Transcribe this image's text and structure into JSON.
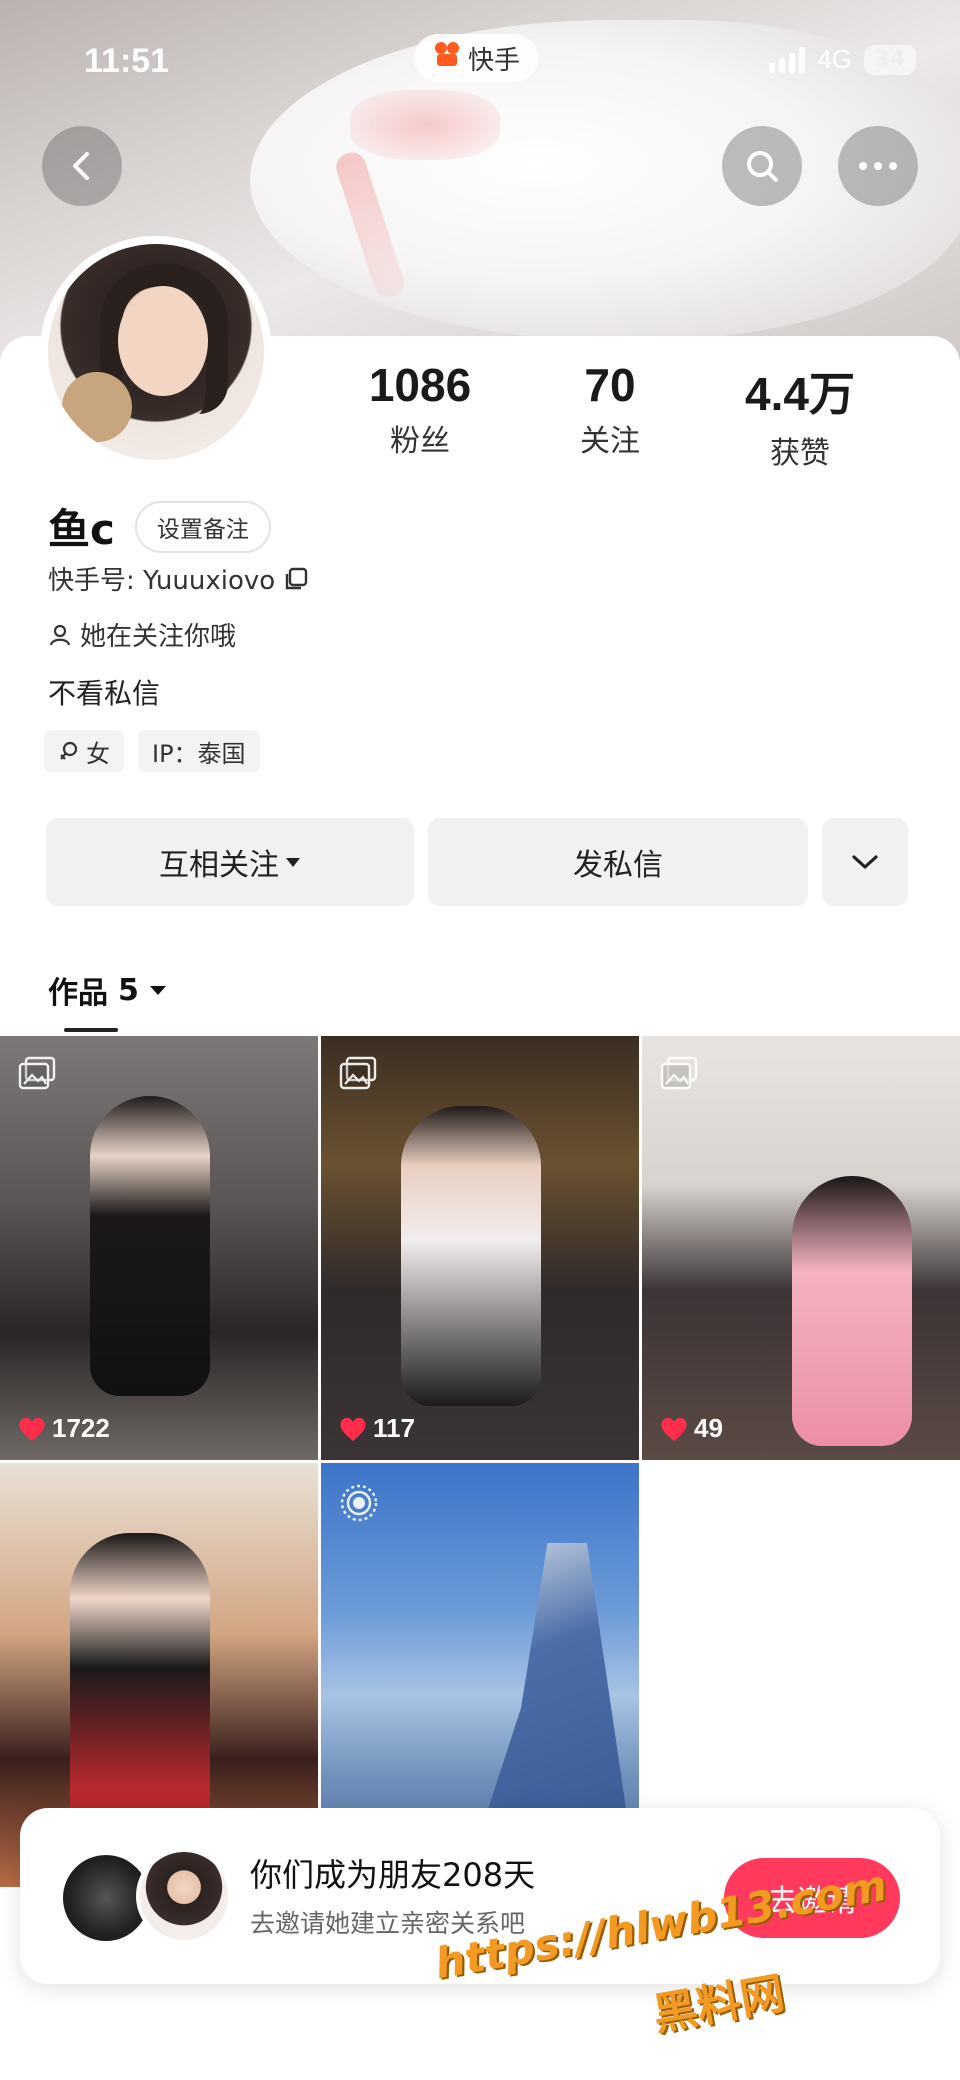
{
  "status_bar": {
    "time": "11:51",
    "app_name": "快手",
    "network": "4G",
    "battery": "34"
  },
  "header": {
    "back_icon": "chevron-left-icon",
    "search_icon": "search-icon",
    "more_icon": "more-dots-icon"
  },
  "profile": {
    "name": "鱼c",
    "remark_button": "设置备注",
    "kuaishou_id": "快手号: Yuuuxiovo",
    "relation": "她在关注你哦",
    "bio": "不看私信",
    "tags": [
      {
        "label": "女",
        "icon": "female-icon"
      },
      {
        "label": "IP：泰国"
      }
    ]
  },
  "stats": [
    {
      "num": "1086",
      "label": "粉丝"
    },
    {
      "num": "70",
      "label": "关注"
    },
    {
      "num": "4.4万",
      "label": "获赞"
    }
  ],
  "actions": {
    "follow": "互相关注",
    "message": "发私信"
  },
  "works": {
    "label": "作品",
    "count": "5"
  },
  "posts": [
    {
      "likes": "1722",
      "type": "image"
    },
    {
      "likes": "117",
      "type": "image"
    },
    {
      "likes": "49",
      "type": "image"
    },
    {
      "likes": "",
      "type": "image"
    },
    {
      "likes": "",
      "type": "live"
    }
  ],
  "friend_card": {
    "title": "你们成为朋友208天",
    "subtitle": "去邀请她建立亲密关系吧",
    "button": "去邀请"
  },
  "watermark": {
    "url": "https://hlwb13.com",
    "site": "黑料网"
  },
  "colors": {
    "accent": "#ff3a5c",
    "brand": "#ff5a1f",
    "watermark": "#f39a22"
  }
}
